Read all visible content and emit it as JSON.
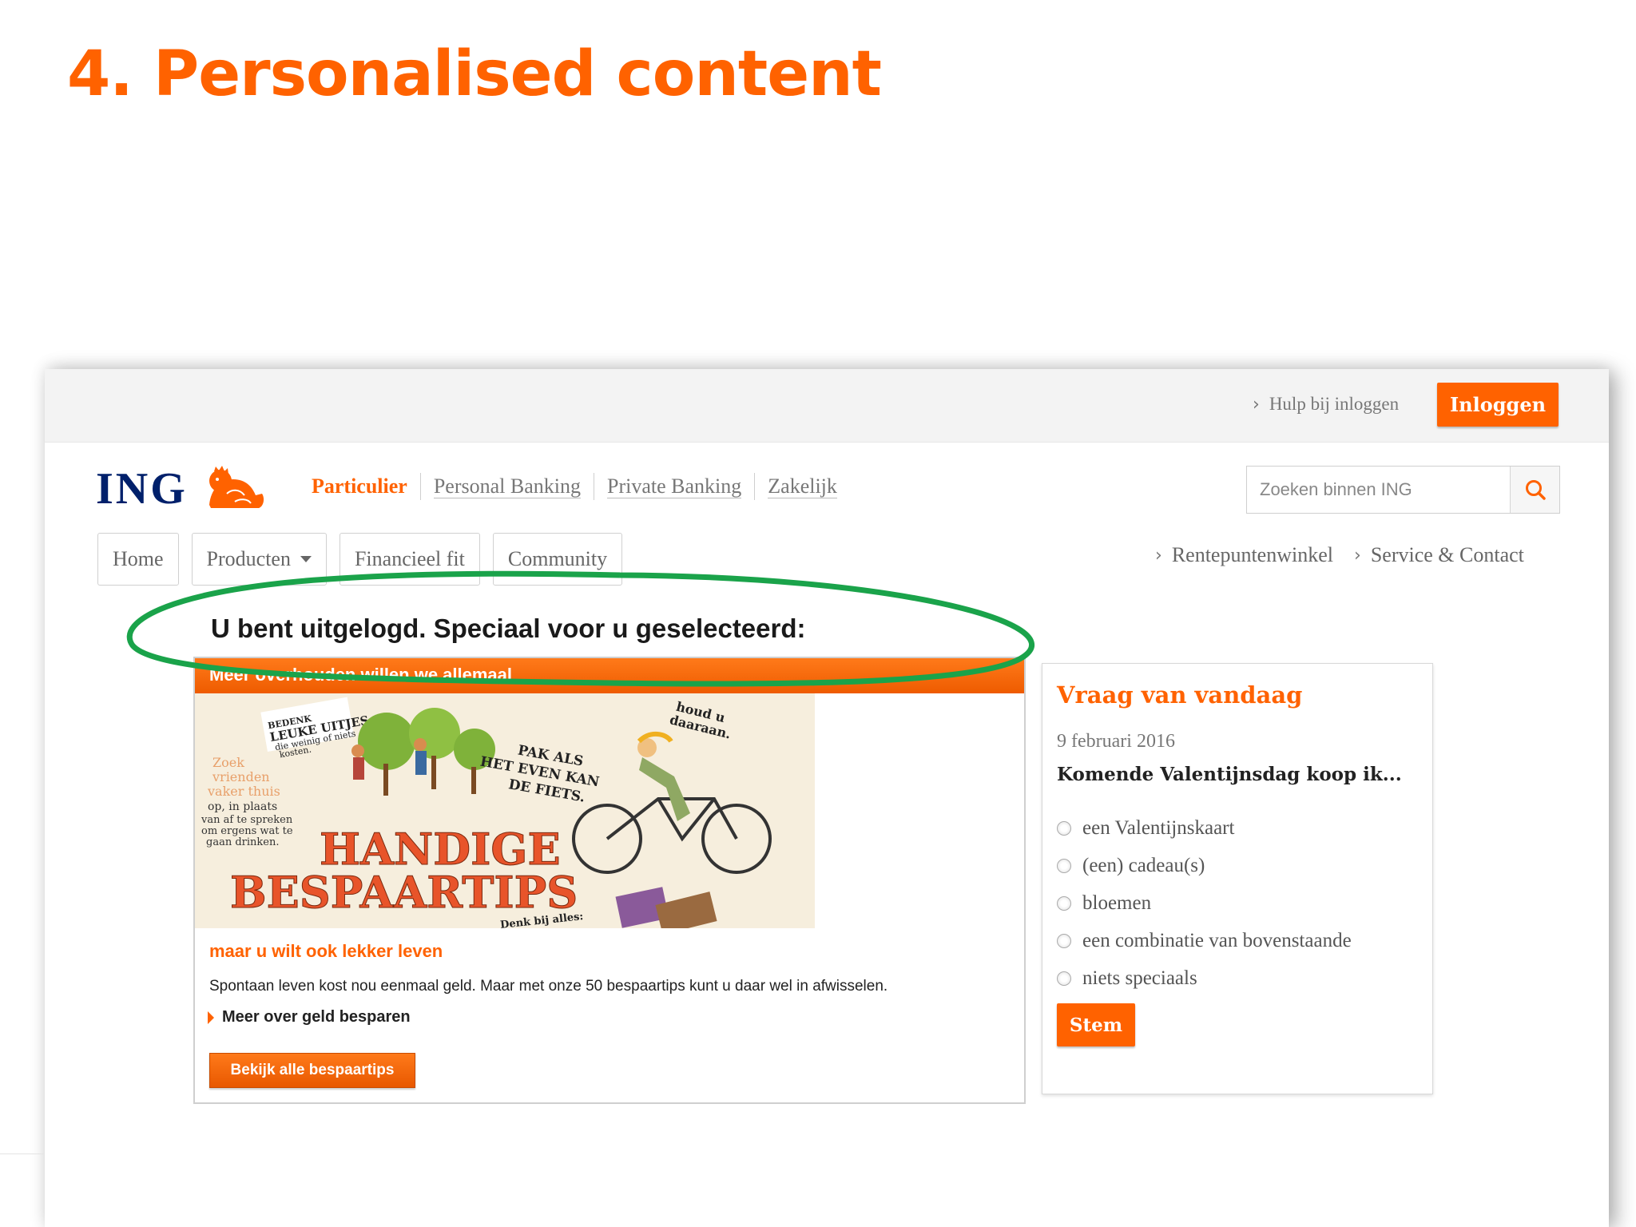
{
  "slide": {
    "title": "4. Personalised content"
  },
  "topbar": {
    "help_link": "Hulp bij inloggen",
    "login_button": "Inloggen"
  },
  "header": {
    "logo": "ING",
    "segments": [
      "Particulier",
      "Personal Banking",
      "Private Banking",
      "Zakelijk"
    ],
    "active_segment": "Particulier",
    "search_placeholder": "Zoeken binnen ING"
  },
  "nav": {
    "tabs": [
      "Home",
      "Producten",
      "Financieel fit",
      "Community"
    ],
    "right_links": [
      "Rentepuntenwinkel",
      "Service & Contact"
    ]
  },
  "main": {
    "headline": "U bent uitgelogd. Speciaal voor u geselecteerd:",
    "teaser": {
      "header": "Meer overhouden willen we allemaal",
      "image_title_line1": "HANDIGE",
      "image_title_line2": "BESPAARTIPS",
      "image_texts": {
        "bedenk": "BEDENK",
        "leuke_uitjes": "LEUKE UITJES",
        "weinig": "die weinig of niets",
        "kosten": "kosten.",
        "fiets_1": "PAK ALS",
        "fiets_2": "HET EVEN KAN",
        "fiets_3": "DE FIETS.",
        "zoek_1": "Zoek",
        "zoek_2": "vrienden",
        "zoek_3": "vaker thuis",
        "zoek_4": "op, in plaats",
        "zoek_5": "van af te spreken",
        "zoek_6": "om ergens wat te",
        "zoek_7": "gaan drinken.",
        "houd": "houd u",
        "daaraan": "daaraan.",
        "denk": "Denk bij alles:"
      },
      "subtitle": "maar u wilt ook lekker leven",
      "text": "Spontaan leven kost nou eenmaal geld. Maar met onze 50 bespaartips kunt u daar wel in afwisselen.",
      "link": "Meer over geld besparen",
      "button": "Bekijk alle bespaartips"
    }
  },
  "poll": {
    "title": "Vraag van vandaag",
    "date": "9 februari 2016",
    "question": "Komende Valentijnsdag koop ik...",
    "options": [
      "een Valentijnskaart",
      "(een) cadeau(s)",
      "bloemen",
      "een combinatie van bovenstaande",
      "niets speciaals"
    ],
    "button": "Stem"
  },
  "colors": {
    "brand_orange": "#ff6200",
    "ing_navy": "#00206b",
    "annotation_green": "#1aa34a"
  },
  "icons": {
    "search": "search-icon",
    "lion": "ing-lion-logo-icon",
    "chevron": "chevron-right-icon",
    "caret": "caret-down-icon"
  }
}
